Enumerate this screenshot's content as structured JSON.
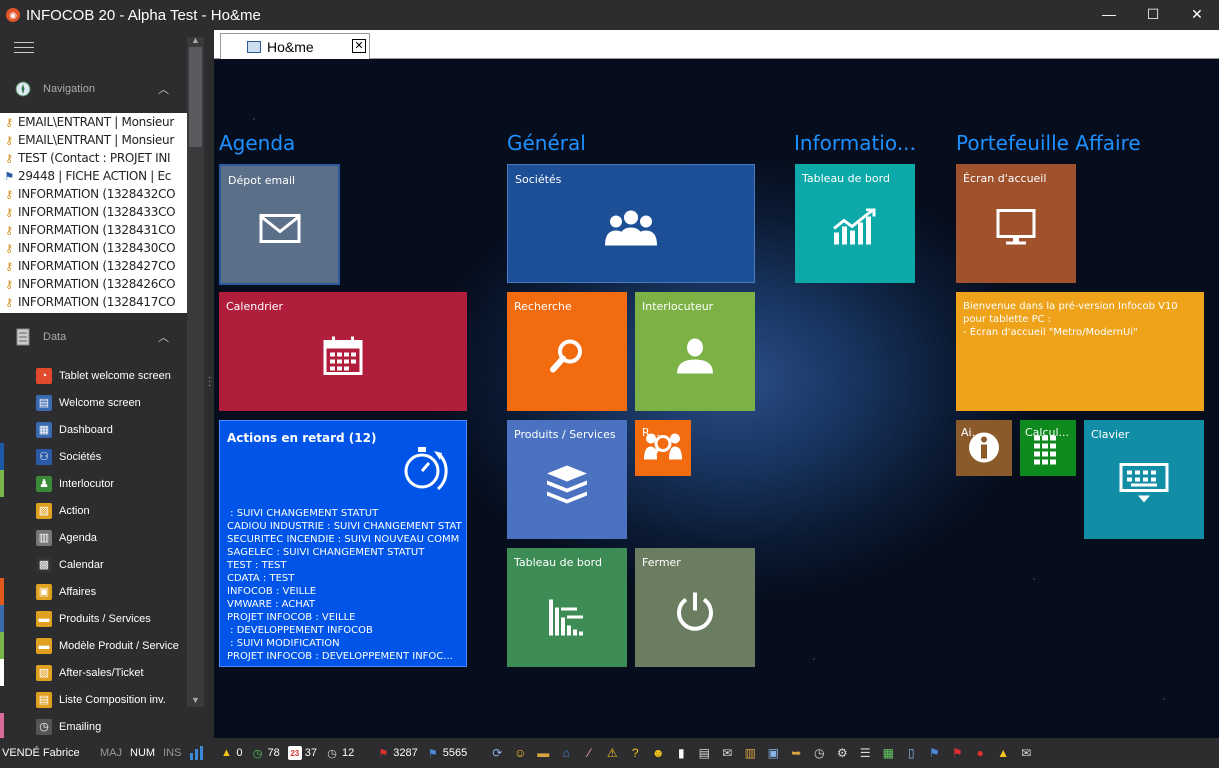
{
  "window": {
    "title": "INFOCOB 20 - Alpha Test - Ho&me",
    "minimize_glyph": "—",
    "maximize_glyph": "☐",
    "close_glyph": "✕"
  },
  "sidebar": {
    "navigation_title": "Navigation",
    "data_title": "Data",
    "recent_items": [
      {
        "icon": "key-icon",
        "label": "EMAIL\\ENTRANT | Monsieur"
      },
      {
        "icon": "key-icon",
        "label": "EMAIL\\ENTRANT | Monsieur"
      },
      {
        "icon": "key-icon",
        "label": "TEST (Contact : PROJET INI"
      },
      {
        "icon": "flag-icon",
        "label": "29448 | FICHE ACTION | Ec"
      },
      {
        "icon": "key-icon",
        "label": "INFORMATION (1328432CO"
      },
      {
        "icon": "key-icon",
        "label": "INFORMATION (1328433CO"
      },
      {
        "icon": "key-icon",
        "label": "INFORMATION (1328431CO"
      },
      {
        "icon": "key-icon",
        "label": "INFORMATION (1328430CO"
      },
      {
        "icon": "key-icon",
        "label": "INFORMATION (1328427CO"
      },
      {
        "icon": "key-icon",
        "label": "INFORMATION (1328426CO"
      },
      {
        "icon": "key-icon",
        "label": "INFORMATION (1328417CO"
      }
    ],
    "data_items": [
      {
        "label": "Tablet welcome screen",
        "icon": "tablet-screen-icon",
        "stripe": "",
        "color": "#e04a2a"
      },
      {
        "label": "Welcome screen",
        "icon": "welcome-screen-icon",
        "stripe": "",
        "color": "#3a6ab0"
      },
      {
        "label": "Dashboard",
        "icon": "dashboard-icon",
        "stripe": "",
        "color": "#3a6ab0"
      },
      {
        "label": "Sociétés",
        "icon": "companies-icon",
        "stripe": "#1c5aa8",
        "color": "#2a5aa8"
      },
      {
        "label": "Interlocutor",
        "icon": "contact-icon",
        "stripe": "#7ab648",
        "color": "#3a8a3a"
      },
      {
        "label": "Action",
        "icon": "action-icon",
        "stripe": "",
        "color": "#e0a020"
      },
      {
        "label": "Agenda",
        "icon": "agenda-icon",
        "stripe": "",
        "color": "#777"
      },
      {
        "label": "Calendar",
        "icon": "calendar-icon",
        "stripe": "",
        "color": "#333"
      },
      {
        "label": "Affaires",
        "icon": "deals-icon",
        "stripe": "#e05a1a",
        "color": "#e0a020"
      },
      {
        "label": "Produits / Services",
        "icon": "products-icon",
        "stripe": "#3a6ab0",
        "color": "#e0a020"
      },
      {
        "label": "Modèle Produit / Service",
        "icon": "product-model-icon",
        "stripe": "#7ab648",
        "color": "#e0a020"
      },
      {
        "label": "After-sales/Ticket",
        "icon": "ticket-icon",
        "stripe": "#ffffff",
        "color": "#e0a020"
      },
      {
        "label": "Liste Composition inv.",
        "icon": "composition-icon",
        "stripe": "",
        "color": "#e0a020"
      },
      {
        "label": "Emailing",
        "icon": "emailing-icon",
        "stripe": "#d86a9a",
        "color": "#555"
      }
    ]
  },
  "tab": {
    "label": "Ho&me",
    "close": "✕"
  },
  "groups": {
    "agenda": "Agenda",
    "general": "Général",
    "information": "Informatio...",
    "portefeuille": "Portefeuille Affaire"
  },
  "tiles": {
    "depot_email": "Dépot email",
    "calendrier": "Calendrier",
    "actions_title": "Actions en retard (12)",
    "actions_lines": [
      " : SUIVI CHANGEMENT STATUT",
      "CADIOU INDUSTRIE : SUIVI CHANGEMENT STAT",
      "SECURITEC INCENDIE : SUIVI NOUVEAU COMM",
      "SAGELEC : SUIVI CHANGEMENT STATUT",
      "TEST : TEST",
      "CDATA : TEST",
      "INFOCOB : VEILLE",
      "VMWARE : ACHAT",
      "PROJET INFOCOB : VEILLE",
      " : DEVELOPPEMENT INFOCOB",
      " : SUIVI MODIFICATION",
      "PROJET INFOCOB : DEVELOPPEMENT INFOC..."
    ],
    "societes": "Sociétés",
    "recherche": "Recherche",
    "interlocuteur": "Interlocuteur",
    "produits": "Produits / Services",
    "small_search": "R...",
    "tableau_bord_green": "Tableau de bord",
    "fermer": "Fermer",
    "tableau_bord_teal": "Tableau de bord",
    "ecran_accueil": "Écran d'accueil",
    "bienvenue_lines": [
      "Bienvenue dans la pré-version Infocob V10",
      "pour tablette PC :",
      "- Écran d'accueil \"Metro/ModernUi\""
    ],
    "small_info": "Ai...",
    "small_calc": "Calcul...",
    "clavier": "Clavier"
  },
  "colors": {
    "agenda_title": "#1e90ff",
    "depot_email": "#5b7088",
    "calendrier": "#b01e3c",
    "actions": "#0055e8",
    "societes": "#1c4f96",
    "recherche": "#f26b0f",
    "interlocuteur": "#7cb245",
    "produits": "#4a72c0",
    "tableau_green": "#3d8c56",
    "fermer": "#6b7d60",
    "tableau_teal": "#0da9a9",
    "ecran_accueil": "#a0522d",
    "bienvenue": "#eea31a",
    "clavier": "#118ea6"
  },
  "statusbar": {
    "user": "VENDÉ Fabrice",
    "maj": "MAJ",
    "num": "NUM",
    "ins": "INS",
    "counts": [
      {
        "icon": "bell-icon",
        "value": "0"
      },
      {
        "icon": "clock-green-icon",
        "value": "78"
      },
      {
        "icon": "calendar-23-icon",
        "value": "37"
      },
      {
        "icon": "alarm-icon",
        "value": "12"
      },
      {
        "icon": "red-flag-icon",
        "value": "3287"
      },
      {
        "icon": "blue-flag-icon",
        "value": "5565"
      }
    ],
    "calendar_day": "23"
  }
}
